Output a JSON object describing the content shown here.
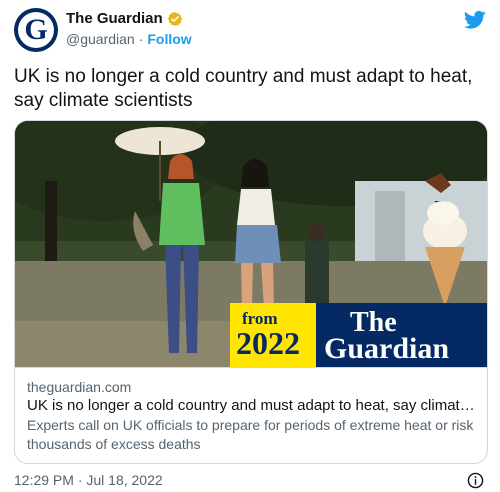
{
  "account": {
    "display_name": "The Guardian",
    "handle": "@guardian",
    "separator": "·",
    "follow_label": "Follow",
    "avatar_letter": "G"
  },
  "tweet": {
    "text": "UK is no longer a cold country and must adapt to heat, say climate scientists",
    "timestamp": "12:29 PM · Jul 18, 2022"
  },
  "card": {
    "image_overlay": {
      "from_label": "from",
      "year": "2022",
      "brand_line1": "The",
      "brand_line2": "Guardian"
    },
    "domain": "theguardian.com",
    "title": "UK is no longer a cold country and must adapt to heat, say climate scien…",
    "description": "Experts call on UK officials to prepare for periods of extreme heat or risk thousands of excess deaths"
  },
  "colors": {
    "twitter_blue": "#1d9bf0",
    "guardian_navy": "#052962",
    "guardian_yellow": "#ffe500",
    "verified_gold": "#e2b719"
  },
  "icons": [
    "verified-badge-icon",
    "twitter-bird-icon",
    "info-icon"
  ]
}
